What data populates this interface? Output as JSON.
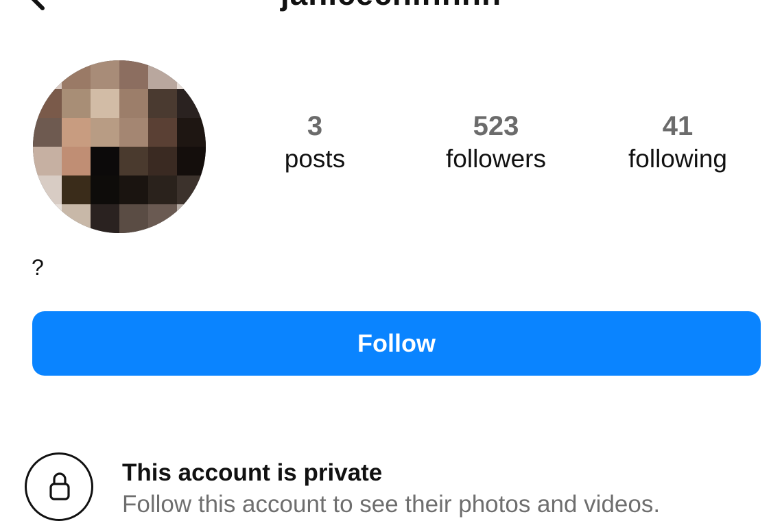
{
  "header": {
    "username": "janicechinnnn",
    "back_icon": "chevron-left-icon"
  },
  "profile": {
    "avatar_icon": "pixelated-avatar",
    "stats": {
      "posts": {
        "value": "3",
        "label": "posts"
      },
      "followers": {
        "value": "523",
        "label": "followers"
      },
      "following": {
        "value": "41",
        "label": "following"
      }
    },
    "bio": "?"
  },
  "actions": {
    "follow_label": "Follow",
    "accent_color": "#0a84ff"
  },
  "private_notice": {
    "icon": "lock-icon",
    "title": "This account is private",
    "subtitle": "Follow this account to see their photos and videos."
  }
}
